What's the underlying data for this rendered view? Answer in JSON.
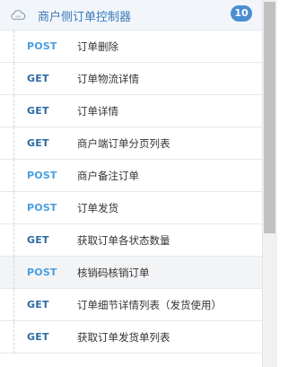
{
  "group": {
    "icon": "cloud-api-icon",
    "title": "商户侧订单控制器",
    "count": "10"
  },
  "endpoints": [
    {
      "method": "POST",
      "name": "订单删除"
    },
    {
      "method": "GET",
      "name": "订单物流详情"
    },
    {
      "method": "GET",
      "name": "订单详情"
    },
    {
      "method": "GET",
      "name": "商户端订单分页列表"
    },
    {
      "method": "POST",
      "name": "商户备注订单"
    },
    {
      "method": "POST",
      "name": "订单发货"
    },
    {
      "method": "GET",
      "name": "获取订单各状态数量"
    },
    {
      "method": "POST",
      "name": "核销码核销订单"
    },
    {
      "method": "GET",
      "name": "订单细节详情列表（发货使用）"
    },
    {
      "method": "GET",
      "name": "获取订单发货单列表"
    }
  ],
  "colors": {
    "post": "#4a9ee0",
    "get": "#2d6aa3",
    "badge": "#4a8fd1",
    "title": "#3a78b8"
  }
}
